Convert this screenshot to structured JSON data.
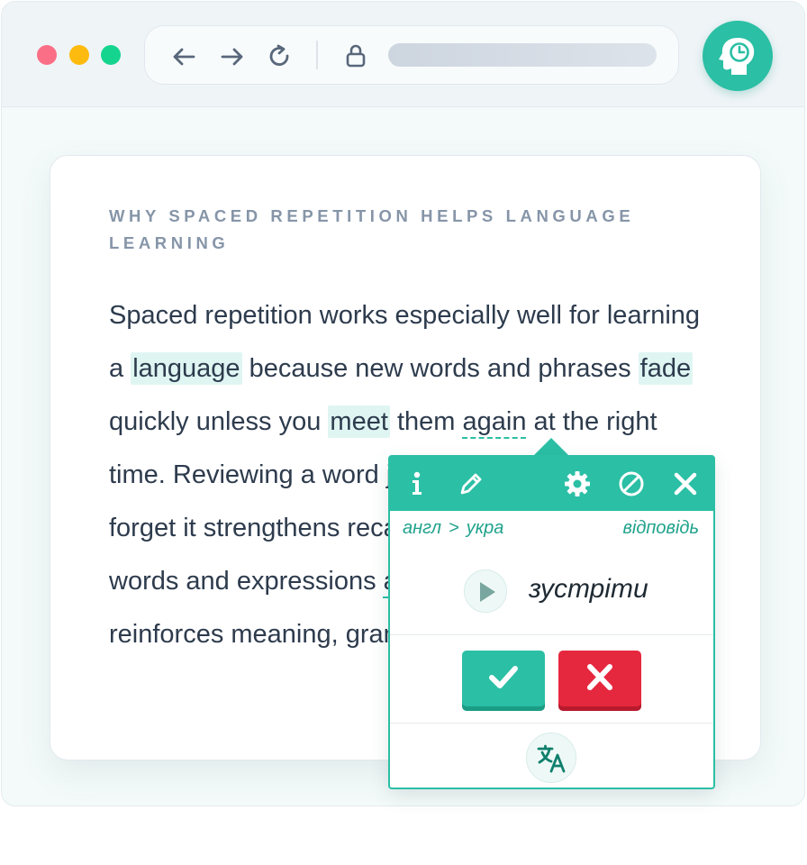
{
  "browser": {
    "window_controls": [
      "close",
      "minimize",
      "maximize"
    ],
    "nav_icons": [
      "back-arrow-icon",
      "forward-arrow-icon",
      "reload-icon",
      "lock-icon"
    ],
    "extension_icon": "brain-clock-icon"
  },
  "article": {
    "eyebrow": "WHY SPACED REPETITION HELPS LANGUAGE LEARNING",
    "segments": [
      "Spaced repetition works especially well for learning a ",
      "language",
      " because new words and phrases ",
      "fade",
      " quickly unless you ",
      "meet",
      " them ",
      "again",
      " at the right time. Reviewing a word just before you would forget it strengthens recall, while seeing the same words and expressions ",
      "again",
      " in real texts reinforces meaning, grammar, tone and context."
    ]
  },
  "popup": {
    "header_icons": [
      "info-icon",
      "pencil-icon",
      "gear-icon",
      "block-icon",
      "close-icon"
    ],
    "source_lang": "англ",
    "lang_separator": ">",
    "target_lang": "укра",
    "answer_link": "відповідь",
    "translation": "зустріти",
    "play_icon": "play-icon",
    "correct_icon": "check-icon",
    "wrong_icon": "cross-icon",
    "translate_icon": "translate-icon"
  },
  "colors": {
    "accent": "#2bbfa5",
    "danger": "#e6283f",
    "highlight": "#dff5f2",
    "text": "#2d3b4d"
  }
}
